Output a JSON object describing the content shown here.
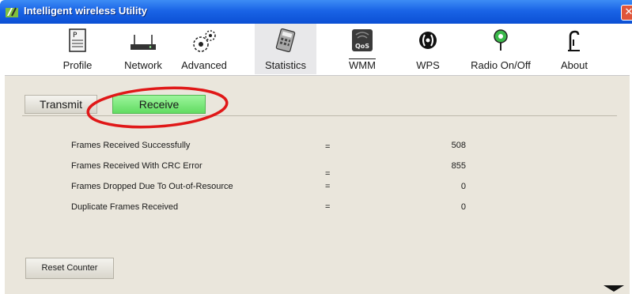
{
  "window": {
    "title": "Intelligent wireless Utility",
    "close_glyph": "✕"
  },
  "toolbar": {
    "items": [
      {
        "label": "Profile",
        "icon": "profile-icon"
      },
      {
        "label": "Network",
        "icon": "network-icon"
      },
      {
        "label": "Advanced",
        "icon": "advanced-icon"
      },
      {
        "label": "Statistics",
        "icon": "statistics-icon",
        "active": true
      },
      {
        "label": "WMM",
        "icon": "qos-icon",
        "badge": "QoS"
      },
      {
        "label": "WPS",
        "icon": "wps-icon"
      },
      {
        "label": "Radio On/Off",
        "icon": "radio-icon"
      },
      {
        "label": "About",
        "icon": "about-icon"
      }
    ]
  },
  "tabs": {
    "transmit": "Transmit",
    "receive": "Receive",
    "active": "receive"
  },
  "stats": [
    {
      "label": "Frames Received Successfully",
      "eq": "=",
      "value": "508"
    },
    {
      "label": "Frames Received With CRC Error",
      "eq": "=",
      "value": "855"
    },
    {
      "label": "Frames Dropped Due To Out-of-Resource",
      "eq": "=",
      "value": "0"
    },
    {
      "label": "Duplicate Frames Received",
      "eq": "=",
      "value": "0"
    }
  ],
  "reset_button": "Reset Counter",
  "colors": {
    "titlebar": "#1a64e6",
    "receive_tab": "#62dc62",
    "highlight": "#e01818",
    "content_bg": "#eae6dc"
  }
}
